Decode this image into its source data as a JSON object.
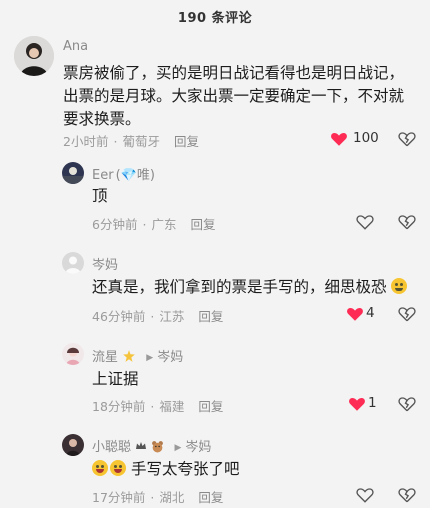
{
  "header": {
    "title": "190 条评论"
  },
  "comments": [
    {
      "user": "Ana",
      "text_lines": [
        "票房被偷了，买的是明日战记看得也是明日战记，",
        "出票的是月球。大家出票一定要确定一下，不对就",
        "要求换票。"
      ],
      "time": "2小时前",
      "location": "葡萄牙",
      "reply": "回复",
      "likes": "100",
      "liked": true
    },
    {
      "user": "Eer",
      "tag": "(💎唯)",
      "text": "顶",
      "time": "6分钟前",
      "location": "广东",
      "reply": "回复",
      "likes": "",
      "liked": false
    },
    {
      "user": "岑妈",
      "text": "还真是，我们拿到的票是手写的，细思极恐",
      "time": "46分钟前",
      "location": "江苏",
      "reply": "回复",
      "likes": "4",
      "liked": true
    },
    {
      "user": "流星",
      "reply_to": "岑妈",
      "text": "上证据",
      "time": "18分钟前",
      "location": "福建",
      "reply": "回复",
      "likes": "1",
      "liked": true
    },
    {
      "user": "小聪聪",
      "reply_to": "岑妈",
      "text": "手写太夸张了吧",
      "time": "17分钟前",
      "location": "湖北",
      "reply": "回复",
      "likes": "",
      "liked": false
    }
  ],
  "colors": {
    "accent": "#fe2c55",
    "muted": "#9b9b9b",
    "background": "#f3f3f3"
  },
  "icons": [
    "heart-icon",
    "broken-heart-icon",
    "play-arrow-icon",
    "star-icon",
    "emoji-icon"
  ]
}
